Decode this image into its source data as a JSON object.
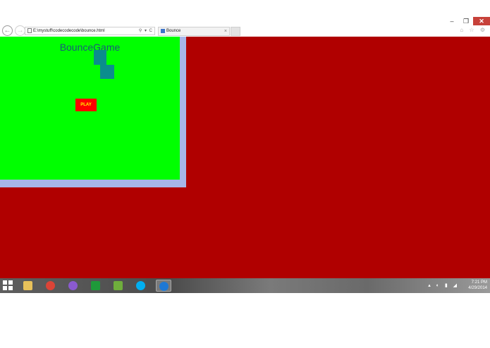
{
  "browser": {
    "address_url": "E:\\mystuff\\codecodecode\\bounce.html",
    "address_tools": "⚲ ▾ C",
    "tab_title": "Bounce",
    "tab_close": "×",
    "back_glyph": "←",
    "forward_glyph": "→",
    "window_controls": {
      "minimize": "–",
      "restore": "❐",
      "close": "✕"
    },
    "right_icons": "⌂ ☆ ⚙"
  },
  "game": {
    "title": "BounceGame",
    "play_label": "PLAY"
  },
  "taskbar": {
    "apps": [
      {
        "name": "file-explorer-icon",
        "color": "#e8c15a"
      },
      {
        "name": "chrome-icon",
        "color": "#db4437"
      },
      {
        "name": "media-icon",
        "color": "#8a5ad0"
      },
      {
        "name": "store-icon",
        "color": "#1f9a3a"
      },
      {
        "name": "photos-icon",
        "color": "#6fae3c"
      },
      {
        "name": "skype-icon",
        "color": "#00aff0"
      },
      {
        "name": "internet-explorer-icon",
        "color": "#1e78d4"
      }
    ],
    "tray_icons": "▴ ◐ ▮ ◢",
    "time": "7:21 PM",
    "date": "4/29/2014"
  },
  "colors": {
    "page_bg": "#b00000",
    "canvas_bg": "#00ff00",
    "block": "#0b8d8d",
    "play_bg": "#ff0000"
  }
}
